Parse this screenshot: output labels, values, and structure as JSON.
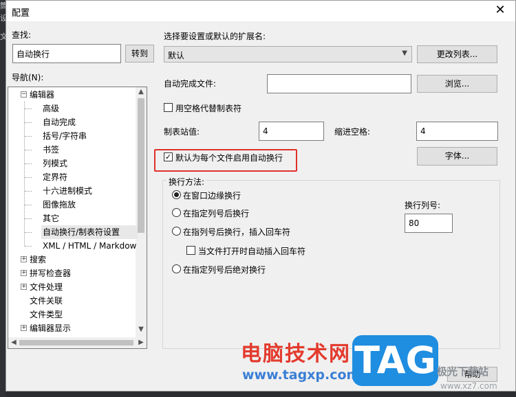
{
  "background": {
    "side_text": [
      "筒",
      "设",
      "文"
    ]
  },
  "dialog": {
    "title": "配置"
  },
  "left": {
    "find_label": "查找:",
    "find_value": "自动换行",
    "goto_button": "转到",
    "nav_label": "导航(N):",
    "tree": [
      {
        "label": "编辑器",
        "level": 0,
        "expander": "−"
      },
      {
        "label": "高级",
        "level": 1
      },
      {
        "label": "自动完成",
        "level": 1
      },
      {
        "label": "括号/字符串",
        "level": 1
      },
      {
        "label": "书签",
        "level": 1
      },
      {
        "label": "列模式",
        "level": 1
      },
      {
        "label": "定界符",
        "level": 1
      },
      {
        "label": "十六进制模式",
        "level": 1
      },
      {
        "label": "图像拖放",
        "level": 1
      },
      {
        "label": "其它",
        "level": 1
      },
      {
        "label": "自动换行/制表符设置",
        "level": 1,
        "selected": true
      },
      {
        "label": "XML / HTML / Markdow",
        "level": 1
      },
      {
        "label": "搜索",
        "level": 0,
        "expander": "+"
      },
      {
        "label": "拼写检查器",
        "level": 0,
        "expander": "+"
      },
      {
        "label": "文件处理",
        "level": 0,
        "expander": "+"
      },
      {
        "label": "文件关联",
        "level": 0
      },
      {
        "label": "文件类型",
        "level": 0
      },
      {
        "label": "编辑器显示",
        "level": 0,
        "expander": "+"
      }
    ]
  },
  "right": {
    "ext_label": "选择要设置或默认的扩展名:",
    "ext_value": "默认",
    "change_list_button": "更改列表...",
    "autocomplete_label": "自动完成文件:",
    "autocomplete_value": "",
    "browse_button": "浏览...",
    "use_spaces_label": "用空格代替制表符",
    "use_spaces_checked": false,
    "tab_stop_label": "制表站值:",
    "tab_stop_value": "4",
    "indent_label": "缩进空格:",
    "indent_value": "4",
    "wrap_default_label": "默认为每个文件启用自动换行",
    "wrap_default_checked": true,
    "font_button": "字体...",
    "wrap_method_label": "换行方法:",
    "wrap_options": [
      {
        "label": "在窗口边缘换行",
        "checked": true
      },
      {
        "label": "在指定列号后换行",
        "checked": false
      },
      {
        "label": "在指列号后换行，插入回车符",
        "checked": false
      },
      {
        "label": "在指定列号后绝对换行",
        "checked": false
      }
    ],
    "insert_cr_label": "当文件打开时自动插入回车符",
    "insert_cr_checked": false,
    "wrap_column_label": "换行列号:",
    "wrap_column_value": "80",
    "help_button": "帮助"
  },
  "watermark": {
    "line1": "电脑技术网",
    "line2": "www.tagxp.com",
    "logo": "TAG",
    "brand": "极光下载站",
    "url": "www.xz7.com"
  },
  "colors": {
    "highlight_border": "#e0302b",
    "watermark_red": "#e33b2e",
    "watermark_blue": "#1f8de0"
  }
}
